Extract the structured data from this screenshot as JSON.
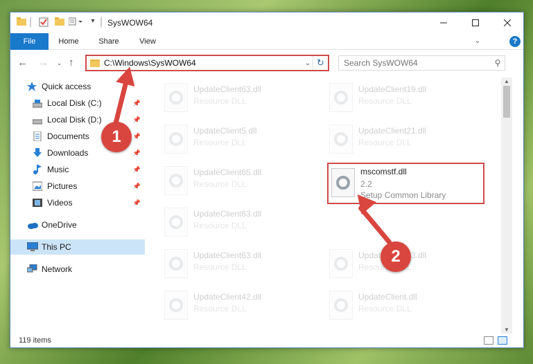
{
  "window": {
    "title": "SysWOW64"
  },
  "ribbon": {
    "tabs": [
      "File",
      "Home",
      "Share",
      "View"
    ],
    "help": "?"
  },
  "address": {
    "path": "C:\\Windows\\SysWOW64"
  },
  "search": {
    "placeholder": "Search SysWOW64"
  },
  "sidebar": {
    "items": [
      {
        "label": "Quick access"
      },
      {
        "label": "Local Disk (C:)"
      },
      {
        "label": "Local Disk (D:)"
      },
      {
        "label": "Documents"
      },
      {
        "label": "Downloads"
      },
      {
        "label": "Music"
      },
      {
        "label": "Pictures"
      },
      {
        "label": "Videos"
      },
      {
        "label": "OneDrive"
      },
      {
        "label": "This PC"
      },
      {
        "label": "Network"
      }
    ]
  },
  "files": {
    "left": [
      {
        "name": "UpdateClient63.dll",
        "desc": "Resource DLL"
      },
      {
        "name": "UpdateClient5.dll",
        "desc": "Resource DLL"
      },
      {
        "name": "UpdateClient65.dll",
        "desc": "Resource DLL"
      },
      {
        "name": "UpdateClient63.dll",
        "desc": "Resource DLL"
      },
      {
        "name": "UpdateClient63.dll",
        "desc": "Resource DLL"
      },
      {
        "name": "UpdateClient42.dll",
        "desc": "Resource DLL"
      }
    ],
    "right": [
      {
        "name": "UpdateClient19.dll",
        "desc": "Resource DLL"
      },
      {
        "name": "UpdateClient21.dll",
        "desc": "Resource DLL"
      },
      {
        "name": "mscomstf.dll",
        "version": "2.2",
        "desc": "Setup Common Library"
      },
      {
        "name": "UpdateClient63.dll",
        "desc": "Resource DLL"
      },
      {
        "name": "UpdateClient63.dll",
        "desc": "Resource DLL"
      },
      {
        "name": "UpdateClient.dll",
        "desc": "Resource DLL"
      }
    ]
  },
  "status": {
    "count": "119 items"
  },
  "annotations": {
    "step1": "1",
    "step2": "2"
  },
  "colors": {
    "accent": "#1979ca",
    "highlight": "#cf4a4a",
    "annotation": "#d9463f",
    "selected": "#cce4f7"
  }
}
